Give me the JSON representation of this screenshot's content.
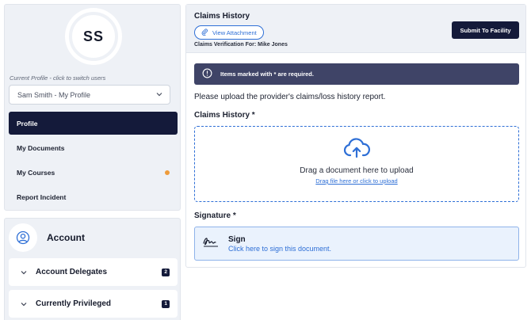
{
  "profile": {
    "initials": "SS",
    "caption": "Current Profile - click to switch users",
    "selected_profile": "Sam Smith - My Profile"
  },
  "nav": {
    "items": [
      {
        "label": "Profile",
        "active": true
      },
      {
        "label": "My Documents"
      },
      {
        "label": "My Courses",
        "has_notification_dot": true
      },
      {
        "label": "Report Incident"
      }
    ]
  },
  "account": {
    "title": "Account",
    "sections": [
      {
        "label": "Account Delegates",
        "count": "2"
      },
      {
        "label": "Currently Privileged",
        "count": "1"
      }
    ]
  },
  "main": {
    "title": "Claims History",
    "view_attachment_label": "View Attachment",
    "verification_text": "Claims Verification For: Mike Jones",
    "submit_label": "Submit To Facility",
    "alert_text": "Items marked with * are required.",
    "instruction": "Please upload the provider's claims/loss history report.",
    "claims_label": "Claims History *",
    "dropzone_text": "Drag a document here to upload",
    "dropzone_link": "Drag file here or click to upload",
    "signature_label": "Signature *",
    "sign_title": "Sign",
    "sign_subtitle": "Click here to sign this document."
  },
  "colors": {
    "navy": "#141a3a",
    "accent_blue": "#2e6fd6",
    "alert_bg": "#3f4467",
    "notification_dot": "#ee9b3b",
    "panel_bg": "#eef1f6"
  }
}
